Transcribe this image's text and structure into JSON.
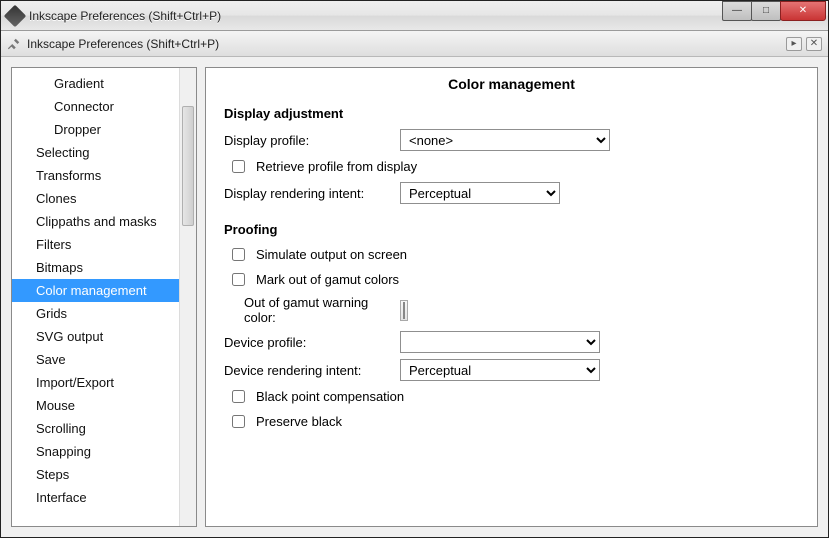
{
  "window": {
    "title": "Inkscape Preferences (Shift+Ctrl+P)",
    "inner_title": "Inkscape Preferences (Shift+Ctrl+P)"
  },
  "sidebar": {
    "items": [
      {
        "label": "Gradient",
        "level": 2,
        "selected": false
      },
      {
        "label": "Connector",
        "level": 2,
        "selected": false
      },
      {
        "label": "Dropper",
        "level": 2,
        "selected": false
      },
      {
        "label": "Selecting",
        "level": 1,
        "selected": false
      },
      {
        "label": "Transforms",
        "level": 1,
        "selected": false
      },
      {
        "label": "Clones",
        "level": 1,
        "selected": false
      },
      {
        "label": "Clippaths and masks",
        "level": 1,
        "selected": false
      },
      {
        "label": "Filters",
        "level": 1,
        "selected": false
      },
      {
        "label": "Bitmaps",
        "level": 1,
        "selected": false
      },
      {
        "label": "Color management",
        "level": 1,
        "selected": true
      },
      {
        "label": "Grids",
        "level": 1,
        "selected": false
      },
      {
        "label": "SVG output",
        "level": 1,
        "selected": false
      },
      {
        "label": "Save",
        "level": 1,
        "selected": false
      },
      {
        "label": "Import/Export",
        "level": 1,
        "selected": false
      },
      {
        "label": "Mouse",
        "level": 1,
        "selected": false
      },
      {
        "label": "Scrolling",
        "level": 1,
        "selected": false
      },
      {
        "label": "Snapping",
        "level": 1,
        "selected": false
      },
      {
        "label": "Steps",
        "level": 1,
        "selected": false
      },
      {
        "label": "Interface",
        "level": 1,
        "selected": false
      }
    ]
  },
  "panel": {
    "title": "Color management",
    "display": {
      "heading": "Display adjustment",
      "profile_label": "Display profile:",
      "profile_value": "<none>",
      "retrieve_label": "Retrieve profile from display",
      "render_label": "Display rendering intent:",
      "render_value": "Perceptual"
    },
    "proofing": {
      "heading": "Proofing",
      "simulate_label": "Simulate output on screen",
      "mark_gamut_label": "Mark out of gamut colors",
      "gamut_color_label": "Out of gamut warning color:",
      "gamut_color_value": "#808080",
      "device_profile_label": "Device profile:",
      "device_profile_value": "",
      "device_render_label": "Device rendering intent:",
      "device_render_value": "Perceptual",
      "black_point_label": "Black point compensation",
      "preserve_black_label": "Preserve black"
    }
  }
}
